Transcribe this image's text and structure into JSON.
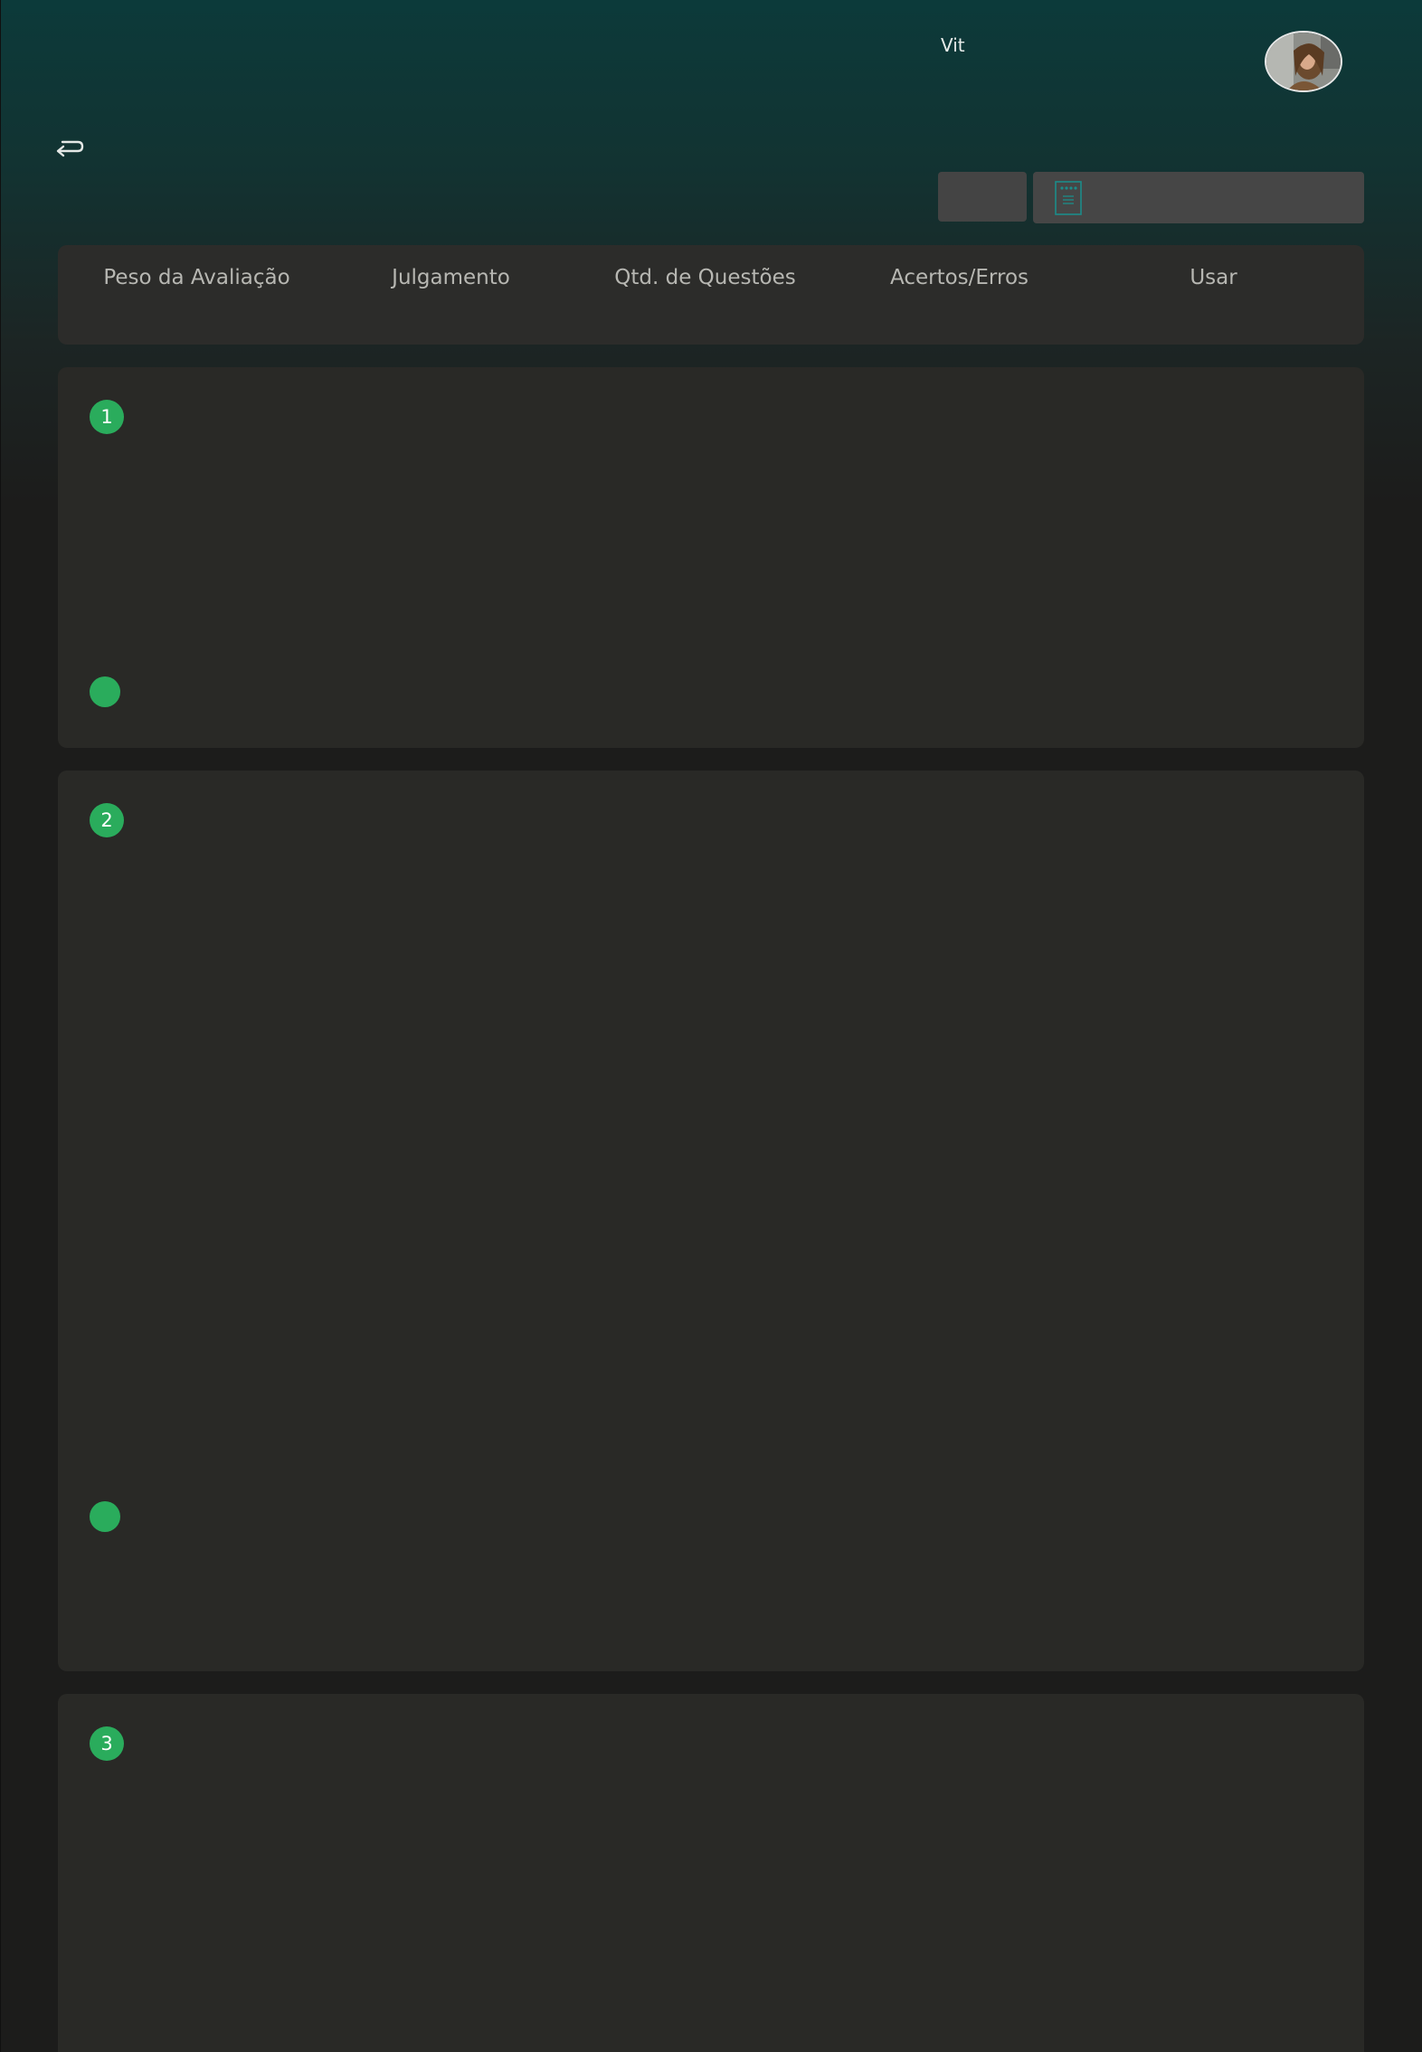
{
  "header": {
    "user_name": "Vit",
    "avatar": "user-avatar-photo",
    "back_icon": "return-arrow-icon",
    "form_icon": "form-document-icon"
  },
  "columns": [
    {
      "label": "Peso da Avaliação"
    },
    {
      "label": "Julgamento"
    },
    {
      "label": "Qtd. de Questões"
    },
    {
      "label": "Acertos/Erros"
    },
    {
      "label": "Usar"
    }
  ],
  "questions": [
    {
      "number": "1"
    },
    {
      "number": "2"
    },
    {
      "number": "3"
    }
  ],
  "colors": {
    "accent_green": "#2aac5c",
    "header_teal": "#0c3a3a",
    "card_bg": "#292926",
    "form_icon_teal": "#1b8c8a"
  }
}
